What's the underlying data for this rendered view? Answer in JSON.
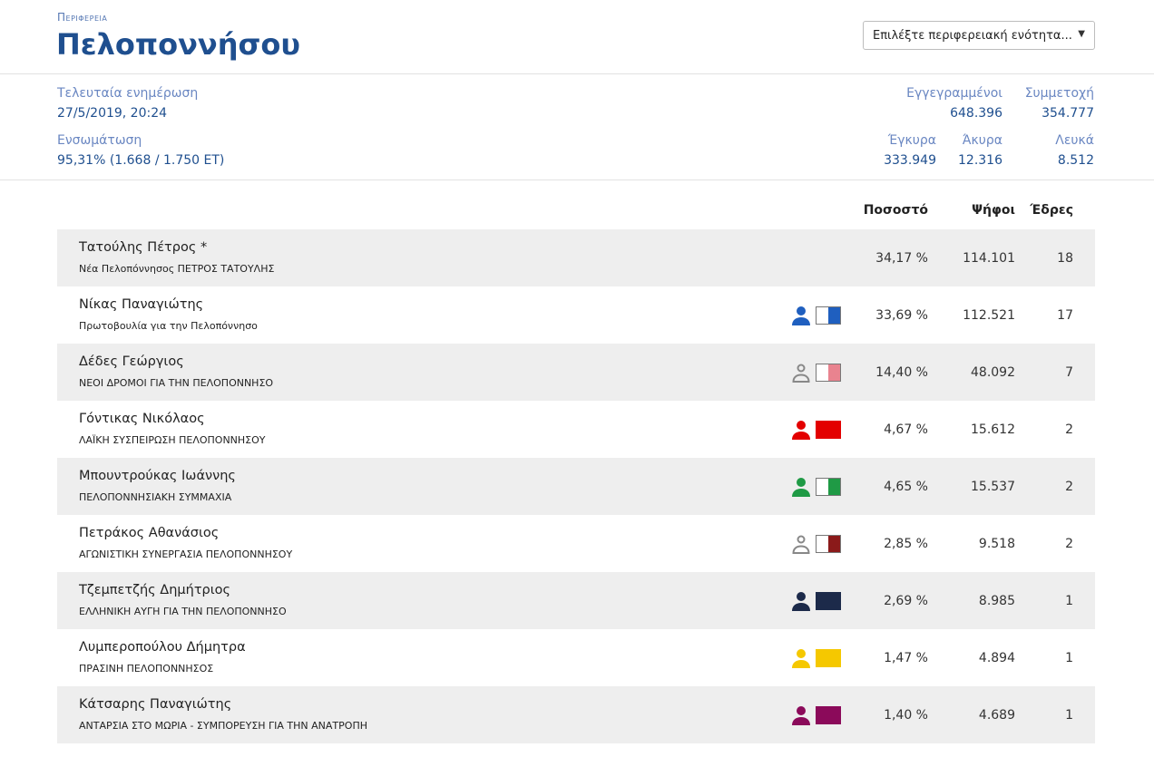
{
  "header": {
    "region_label": "Περιφερεια",
    "region_name": "Πελοποννήσου",
    "select_placeholder": "Επιλέξτε περιφερειακή ενότητα..."
  },
  "meta": {
    "updated_label": "Τελευταία ενημέρωση",
    "updated_value": "27/5/2019, 20:24",
    "integration_label": "Ενσωμάτωση",
    "integration_value": "95,31% (1.668 / 1.750 ΕΤ)",
    "registered_label": "Εγγεγραμμένοι",
    "registered_value": "648.396",
    "turnout_label": "Συμμετοχή",
    "turnout_value": "354.777",
    "valid_label": "Έγκυρα",
    "valid_value": "333.949",
    "invalid_label": "Άκυρα",
    "invalid_value": "12.316",
    "blank_label": "Λευκά",
    "blank_value": "8.512"
  },
  "table": {
    "col_pct": "Ποσοστό",
    "col_votes": "Ψήφοι",
    "col_seats": "Έδρες",
    "rows": [
      {
        "name": "Τατούλης Πέτρος *",
        "party": "Νέα Πελοπόννησος ΠΕΤΡΟΣ ΤΑΤΟΥΛΗΣ",
        "pct": "34,17 %",
        "votes": "114.101",
        "seats": "18",
        "icon_color": "",
        "flag_color": "",
        "flag_fill": 0,
        "outline": false
      },
      {
        "name": "Νίκας Παναγιώτης",
        "party": "Πρωτοβουλία για την Πελοπόννησο",
        "pct": "33,69 %",
        "votes": "112.521",
        "seats": "17",
        "icon_color": "#1f5fbf",
        "flag_color": "#1f5fbf",
        "flag_fill": 0.5,
        "outline": false
      },
      {
        "name": "Δέδες Γεώργιος",
        "party": "ΝΕΟΙ ΔΡΟΜΟΙ ΓΙΑ ΤΗΝ ΠΕΛΟΠΟΝΝΗΣΟ",
        "pct": "14,40 %",
        "votes": "48.092",
        "seats": "7",
        "icon_color": "#888888",
        "flag_color": "#e9838f",
        "flag_fill": 0.5,
        "outline": true
      },
      {
        "name": "Γόντικας Νικόλαος",
        "party": "ΛΑΪΚΗ ΣΥΣΠΕΙΡΩΣΗ ΠΕΛΟΠΟΝΝΗΣΟΥ",
        "pct": "4,67 %",
        "votes": "15.612",
        "seats": "2",
        "icon_color": "#e30000",
        "flag_color": "#e30000",
        "flag_fill": 1,
        "outline": false
      },
      {
        "name": "Μπουντρούκας Ιωάννης",
        "party": "ΠΕΛΟΠΟΝΝΗΣΙΑΚΗ ΣΥΜΜΑΧΙΑ",
        "pct": "4,65 %",
        "votes": "15.537",
        "seats": "2",
        "icon_color": "#1f9a45",
        "flag_color": "#1f9a45",
        "flag_fill": 0.5,
        "outline": false
      },
      {
        "name": "Πετράκος Αθανάσιος",
        "party": "ΑΓΩΝΙΣΤΙΚΗ ΣΥΝΕΡΓΑΣΙΑ ΠΕΛΟΠΟΝΝΗΣΟΥ",
        "pct": "2,85 %",
        "votes": "9.518",
        "seats": "2",
        "icon_color": "#888888",
        "flag_color": "#8b1a1a",
        "flag_fill": 0.5,
        "outline": true
      },
      {
        "name": "Τζεμπετζής Δημήτριος",
        "party": "ΕΛΛΗΝΙΚΗ ΑΥΓΗ ΓΙΑ ΤΗΝ ΠΕΛΟΠΟΝΝΗΣΟ",
        "pct": "2,69 %",
        "votes": "8.985",
        "seats": "1",
        "icon_color": "#1c2a4a",
        "flag_color": "#1c2a4a",
        "flag_fill": 1,
        "outline": false
      },
      {
        "name": "Λυμπεροπούλου Δήμητρα",
        "party": "ΠΡΑΣΙΝΗ ΠΕΛΟΠΟΝΝΗΣΟΣ",
        "pct": "1,47 %",
        "votes": "4.894",
        "seats": "1",
        "icon_color": "#f5c800",
        "flag_color": "#f5c800",
        "flag_fill": 1,
        "outline": false
      },
      {
        "name": "Κάτσαρης Παναγιώτης",
        "party": "ΑΝΤΑΡΣΙΑ ΣΤΟ ΜΩΡΙΑ - ΣΥΜΠΟΡΕΥΣΗ ΓΙΑ ΤΗΝ ΑΝΑΤΡΟΠΗ",
        "pct": "1,40 %",
        "votes": "4.689",
        "seats": "1",
        "icon_color": "#8b0a5a",
        "flag_color": "#8b0a5a",
        "flag_fill": 1,
        "outline": false
      }
    ]
  }
}
